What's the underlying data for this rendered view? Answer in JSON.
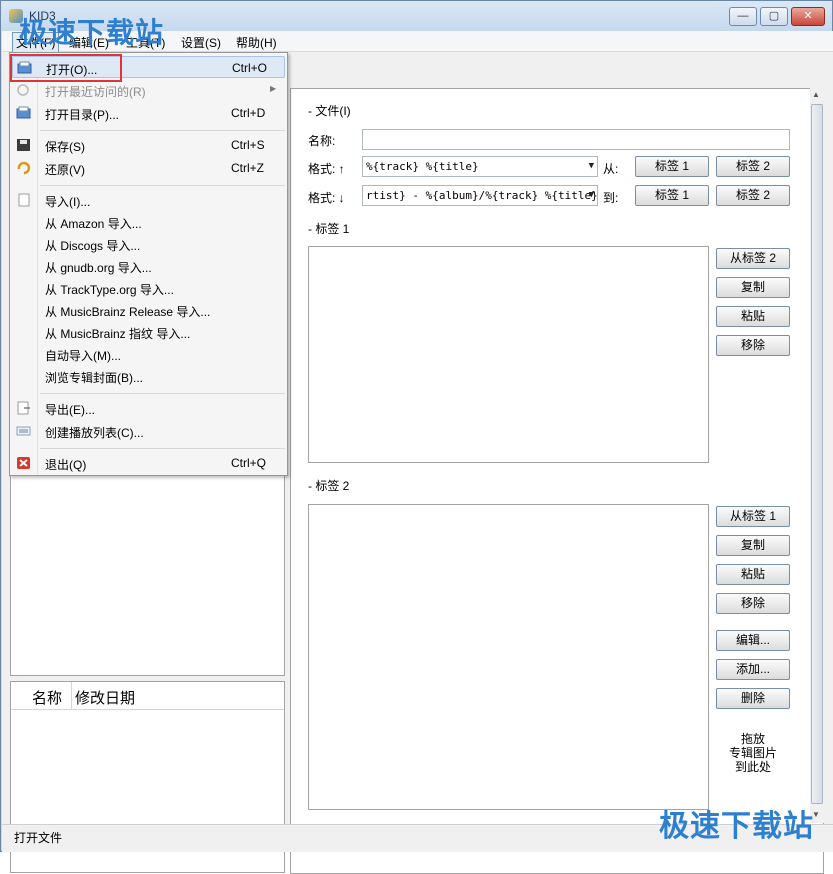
{
  "window": {
    "title": "KID3",
    "watermark": "极速下载站"
  },
  "menubar": [
    "文件(F)",
    "编辑(E)",
    "工具(T)",
    "设置(S)",
    "帮助(H)"
  ],
  "file_menu": {
    "items": [
      {
        "label": "打开(O)...",
        "shortcut": "Ctrl+O",
        "icon": "open-folder-icon"
      },
      {
        "label": "打开最近访问的(R)",
        "shortcut": "",
        "icon": "recent-icon"
      },
      {
        "label": "打开目录(P)...",
        "shortcut": "Ctrl+D",
        "icon": "open-dir-icon"
      },
      {
        "label": "保存(S)",
        "shortcut": "Ctrl+S",
        "icon": "save-icon"
      },
      {
        "label": "还原(V)",
        "shortcut": "Ctrl+Z",
        "icon": "revert-icon"
      },
      {
        "label": "导入(I)...",
        "shortcut": "",
        "icon": "import-icon"
      },
      {
        "label": "从 Amazon 导入...",
        "shortcut": ""
      },
      {
        "label": "从 Discogs 导入...",
        "shortcut": ""
      },
      {
        "label": "从 gnudb.org 导入...",
        "shortcut": ""
      },
      {
        "label": "从 TrackType.org 导入...",
        "shortcut": ""
      },
      {
        "label": "从 MusicBrainz Release 导入...",
        "shortcut": ""
      },
      {
        "label": "从 MusicBrainz 指纹 导入...",
        "shortcut": ""
      },
      {
        "label": "自动导入(M)...",
        "shortcut": ""
      },
      {
        "label": "浏览专辑封面(B)...",
        "shortcut": ""
      },
      {
        "label": "导出(E)...",
        "shortcut": "",
        "icon": "export-icon"
      },
      {
        "label": "创建播放列表(C)...",
        "shortcut": "",
        "icon": "playlist-icon"
      },
      {
        "label": "退出(Q)",
        "shortcut": "Ctrl+Q",
        "icon": "quit-icon"
      }
    ]
  },
  "file_list": {
    "col_name": "名称",
    "col_date": "修改日期"
  },
  "file_section": {
    "header": "文件(I)",
    "name_label": "名称:",
    "name_value": "",
    "format_up_label": "格式: ↑",
    "format_up_value": "%{track} %{title}",
    "from_label": "从:",
    "format_down_label": "格式: ↓",
    "format_down_value": "rtist} - %{album}/%{track} %{title}",
    "to_label": "到:",
    "tag1_btn": "标签 1",
    "tag2_btn": "标签 2"
  },
  "tag1_section": {
    "header": "标签 1",
    "buttons": [
      "从标签 2",
      "复制",
      "粘贴",
      "移除"
    ]
  },
  "tag2_section": {
    "header": "标签 2",
    "buttons": [
      "从标签 1",
      "复制",
      "粘贴",
      "移除",
      "编辑...",
      "添加...",
      "删除"
    ],
    "drop_hint": [
      "拖放",
      "专辑图片",
      "到此处"
    ]
  },
  "statusbar": {
    "text": "打开文件"
  }
}
